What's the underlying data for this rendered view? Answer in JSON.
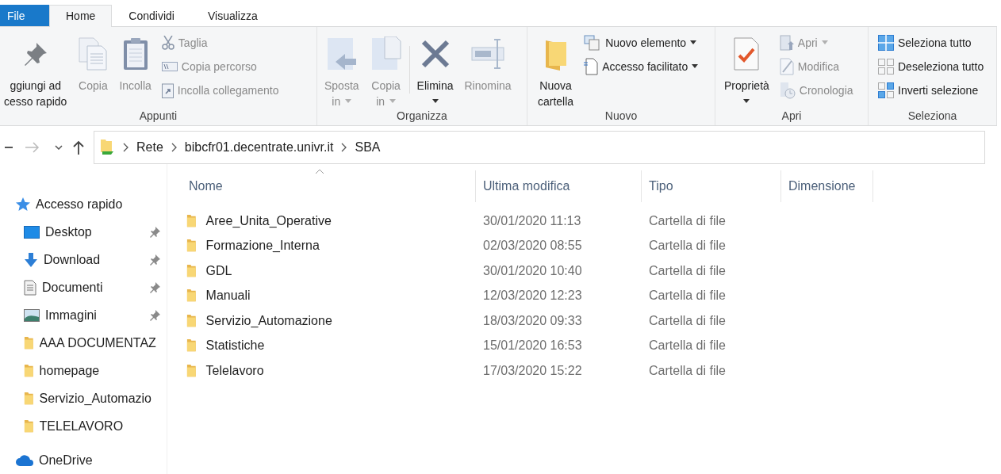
{
  "tabs": [
    {
      "label": "File",
      "kind": "file",
      "selected": false
    },
    {
      "label": "Home",
      "kind": "tab",
      "selected": true
    },
    {
      "label": "Condividi",
      "kind": "tab",
      "selected": false
    },
    {
      "label": "Visualizza",
      "kind": "tab",
      "selected": false
    }
  ],
  "ribbon": [
    {
      "label": "Appunti",
      "items": [
        {
          "kind": "large",
          "lines": [
            "ggiungi ad",
            "cesso rapido"
          ],
          "disabled": false,
          "dropdown": false
        },
        {
          "kind": "large",
          "lines": [
            "Copia"
          ],
          "disabled": true,
          "dropdown": false
        },
        {
          "kind": "large",
          "lines": [
            "Incolla"
          ],
          "disabled": true,
          "dropdown": false
        },
        {
          "kind": "small",
          "label": "Taglia",
          "disabled": true,
          "dropdown": false
        },
        {
          "kind": "small",
          "label": "Copia percorso",
          "disabled": true,
          "dropdown": false
        },
        {
          "kind": "small",
          "label": "Incolla collegamento",
          "disabled": true,
          "dropdown": false
        }
      ]
    },
    {
      "label": "Organizza",
      "items": [
        {
          "kind": "large",
          "lines": [
            "Sposta",
            "in"
          ],
          "disabled": true,
          "dropdown": true
        },
        {
          "kind": "large",
          "lines": [
            "Copia",
            "in"
          ],
          "disabled": true,
          "dropdown": true
        },
        {
          "kind": "separator"
        },
        {
          "kind": "large",
          "lines": [
            "Elimina"
          ],
          "disabled": false,
          "dropdown": true
        },
        {
          "kind": "large",
          "lines": [
            "Rinomina"
          ],
          "disabled": true,
          "dropdown": false
        }
      ]
    },
    {
      "label": "Nuovo",
      "items": [
        {
          "kind": "large",
          "lines": [
            "Nuova",
            "cartella"
          ],
          "disabled": false,
          "dropdown": false
        },
        {
          "kind": "small",
          "label": "Nuovo elemento",
          "disabled": false,
          "dropdown": true
        },
        {
          "kind": "small",
          "label": "Accesso facilitato",
          "disabled": false,
          "dropdown": true
        }
      ]
    },
    {
      "label": "Apri",
      "items": [
        {
          "kind": "large",
          "lines": [
            "Proprietà"
          ],
          "disabled": false,
          "dropdown": true
        },
        {
          "kind": "small",
          "label": "Apri",
          "disabled": true,
          "dropdown": true
        },
        {
          "kind": "small",
          "label": "Modifica",
          "disabled": true,
          "dropdown": false
        },
        {
          "kind": "small",
          "label": "Cronologia",
          "disabled": true,
          "dropdown": false
        }
      ]
    },
    {
      "label": "Seleziona",
      "items": [
        {
          "kind": "small",
          "label": "Seleziona tutto",
          "disabled": false,
          "dropdown": false
        },
        {
          "kind": "small",
          "label": "Deseleziona tutto",
          "disabled": false,
          "dropdown": false
        },
        {
          "kind": "small",
          "label": "Inverti selezione",
          "disabled": false,
          "dropdown": false
        }
      ]
    }
  ],
  "address": {
    "path": [
      "Rete",
      "bibcfr01.decentrate.univr.it",
      "SBA"
    ]
  },
  "sidebar": {
    "items": [
      {
        "label": "Accesso rapido",
        "kind": "quick-access",
        "pinned": false
      },
      {
        "label": "Desktop",
        "kind": "desktop",
        "pinned": true
      },
      {
        "label": "Download",
        "kind": "download",
        "pinned": true
      },
      {
        "label": "Documenti",
        "kind": "documents",
        "pinned": true
      },
      {
        "label": "Immagini",
        "kind": "pictures",
        "pinned": true
      },
      {
        "label": "AAA DOCUMENTAZ",
        "kind": "folder",
        "pinned": false
      },
      {
        "label": "homepage",
        "kind": "folder",
        "pinned": false
      },
      {
        "label": "Servizio_Automazio",
        "kind": "folder",
        "pinned": false
      },
      {
        "label": "TELELAVORO",
        "kind": "folder",
        "pinned": false
      },
      {
        "label": "OneDrive",
        "kind": "onedrive",
        "pinned": false
      }
    ]
  },
  "table": {
    "columns": [
      {
        "label": "Nome",
        "sorted": true
      },
      {
        "label": "Ultima modifica",
        "sorted": false
      },
      {
        "label": "Tipo",
        "sorted": false
      },
      {
        "label": "Dimensione",
        "sorted": false
      }
    ],
    "rows": [
      {
        "name": "Aree_Unita_Operative",
        "modified": "30/01/2020 11:13",
        "type": "Cartella di file"
      },
      {
        "name": "Formazione_Interna",
        "modified": "02/03/2020 08:55",
        "type": "Cartella di file"
      },
      {
        "name": "GDL",
        "modified": "30/01/2020 10:40",
        "type": "Cartella di file"
      },
      {
        "name": "Manuali",
        "modified": "12/03/2020 12:23",
        "type": "Cartella di file"
      },
      {
        "name": "Servizio_Automazione",
        "modified": "18/03/2020 09:33",
        "type": "Cartella di file"
      },
      {
        "name": "Statistiche",
        "modified": "15/01/2020 16:53",
        "type": "Cartella di file"
      },
      {
        "name": "Telelavoro",
        "modified": "17/03/2020 15:22",
        "type": "Cartella di file"
      }
    ]
  }
}
